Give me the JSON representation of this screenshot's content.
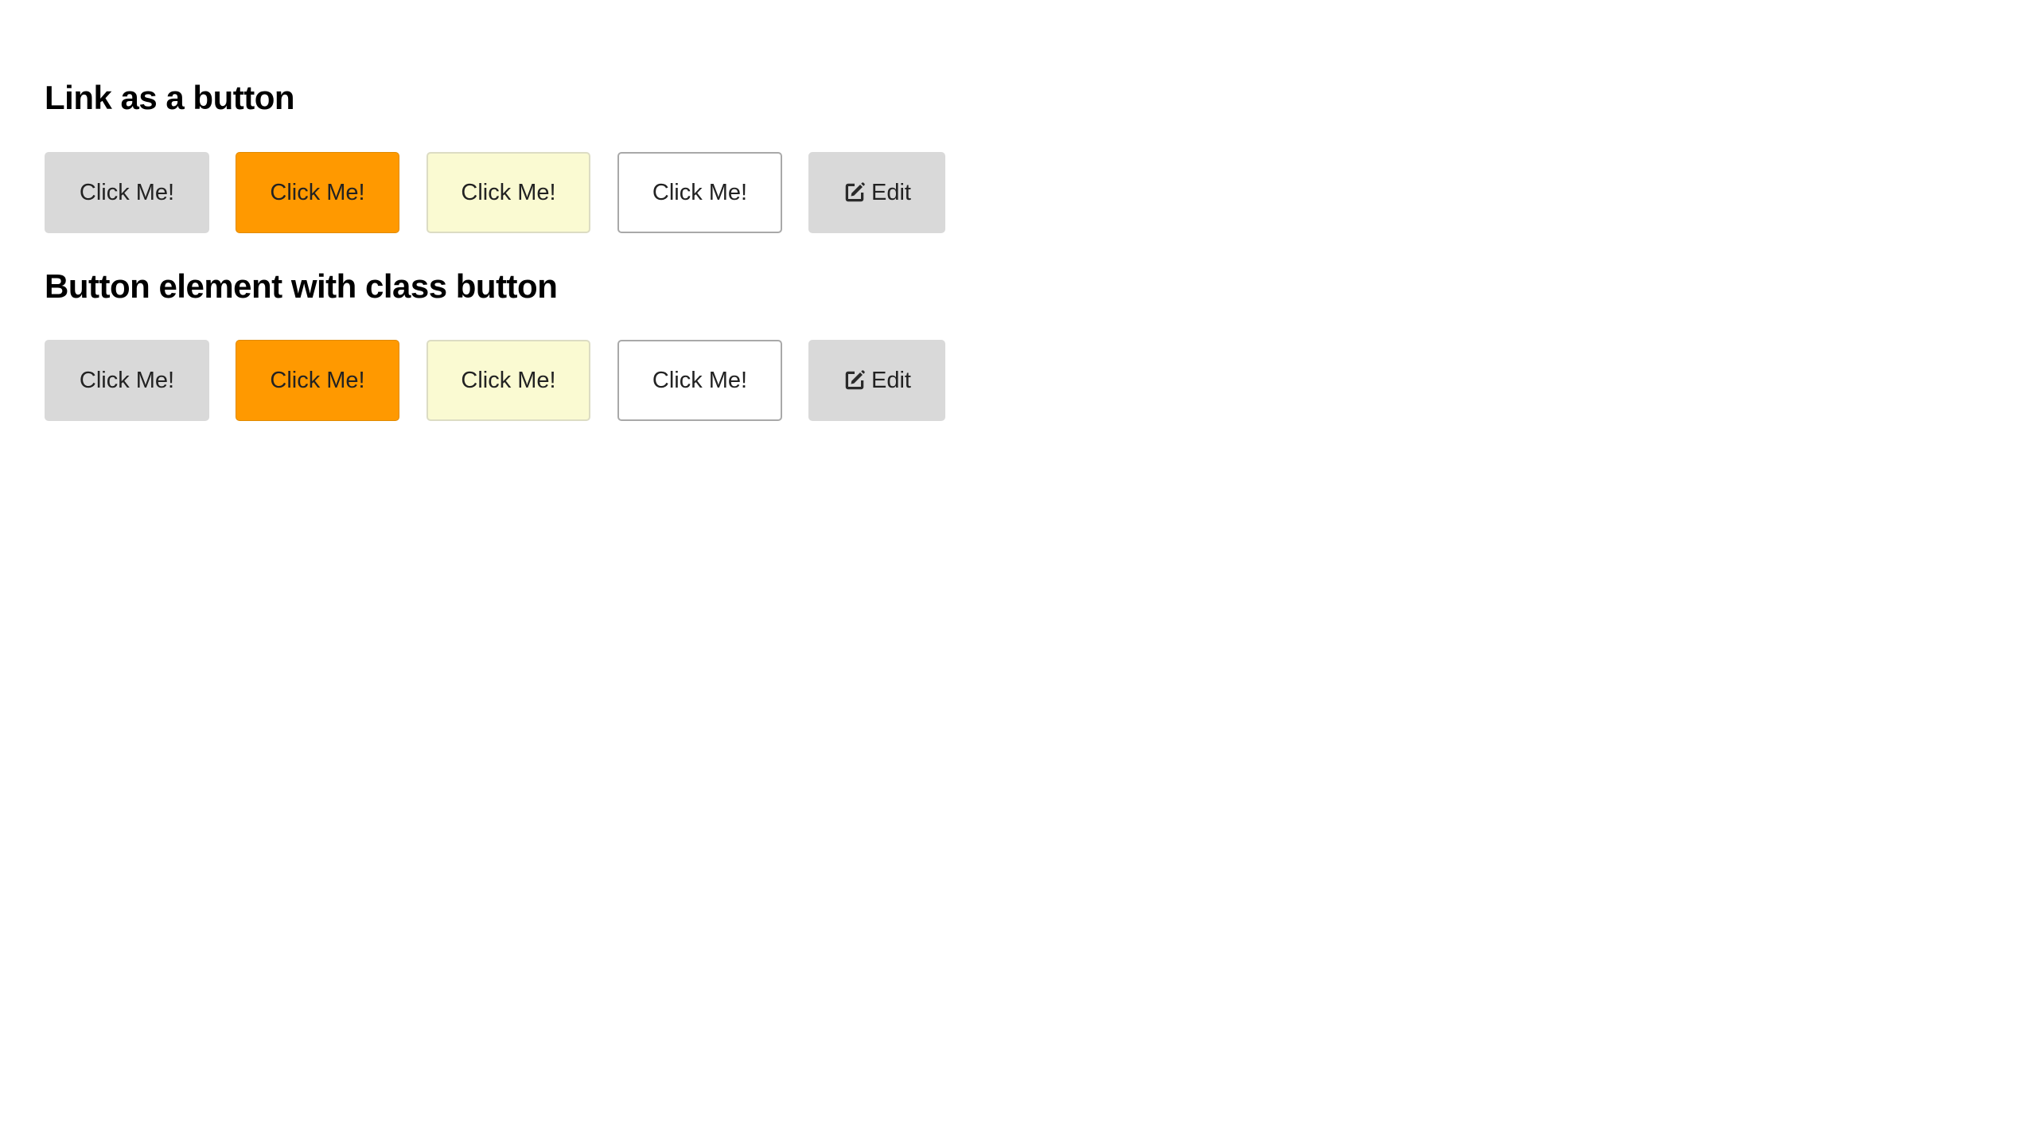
{
  "sections": [
    {
      "title": "Link as a button",
      "buttons": [
        {
          "label": "Click Me!",
          "style": "default"
        },
        {
          "label": "Click Me!",
          "style": "primary"
        },
        {
          "label": "Click Me!",
          "style": "light"
        },
        {
          "label": "Click Me!",
          "style": "outline"
        },
        {
          "label": "Edit",
          "style": "default",
          "icon": "edit-icon"
        }
      ]
    },
    {
      "title": "Button element with class button",
      "buttons": [
        {
          "label": "Click Me!",
          "style": "default"
        },
        {
          "label": "Click Me!",
          "style": "primary"
        },
        {
          "label": "Click Me!",
          "style": "light"
        },
        {
          "label": "Click Me!",
          "style": "outline"
        },
        {
          "label": "Edit",
          "style": "default",
          "icon": "edit-icon"
        }
      ]
    }
  ],
  "colors": {
    "default_bg": "#d9d9d9",
    "primary_bg": "#ff9900",
    "light_bg": "#fafad2",
    "outline_bg": "#ffffff",
    "outline_border": "#a9a9a9",
    "text": "#222222"
  }
}
